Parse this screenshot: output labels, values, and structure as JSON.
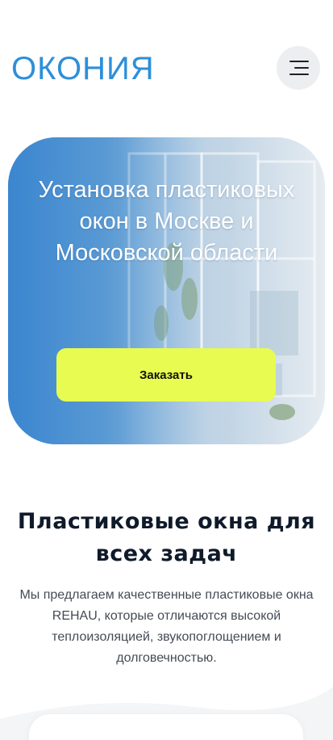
{
  "header": {
    "logo_text": "ОКОНИЯ",
    "menu_icon": "hamburger-menu-icon"
  },
  "hero": {
    "title": "Установка пластиковых окон в Москве и Московской области",
    "order_button_label": "Заказать"
  },
  "section": {
    "title": "Пластиковые окна для всех задач",
    "text": "Мы предлагаем качественные пластиковые окна REHAU, которые отличаются высокой теплоизоляцией, звукопоглощением и долговечностью."
  },
  "colors": {
    "brand_blue": "#2e8fd9",
    "accent_yellow": "#e8fb50",
    "heading_dark": "#0f1a2a"
  }
}
